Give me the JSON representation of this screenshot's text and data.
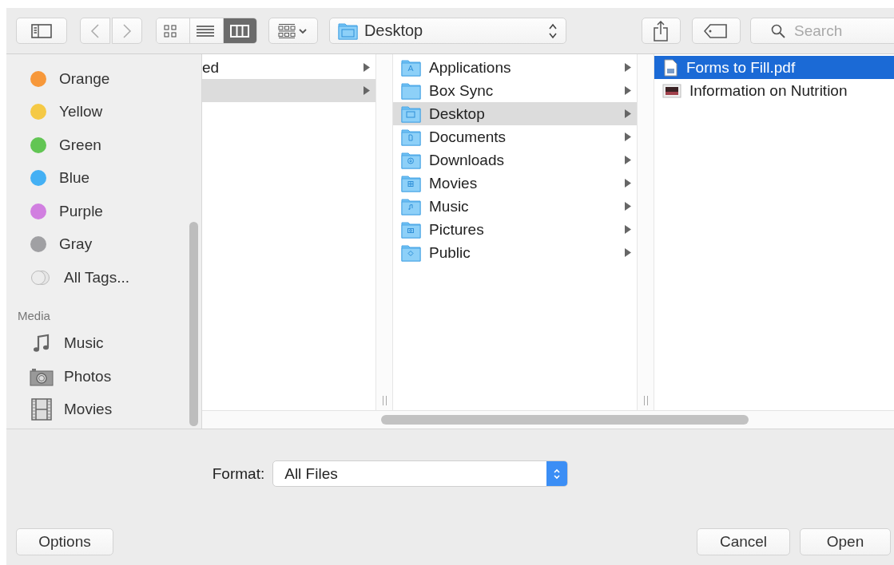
{
  "toolbar": {
    "view_modes": [
      {
        "kind": "icon",
        "selected": false
      },
      {
        "kind": "list",
        "selected": false
      },
      {
        "kind": "column",
        "selected": true
      }
    ],
    "location": "Desktop",
    "search": {
      "placeholder": "Search"
    }
  },
  "sidebar": {
    "tags": [
      {
        "label": "Orange",
        "color": "#f7983a"
      },
      {
        "label": "Yellow",
        "color": "#f5c945"
      },
      {
        "label": "Green",
        "color": "#62c554"
      },
      {
        "label": "Blue",
        "color": "#44b0f4"
      },
      {
        "label": "Purple",
        "color": "#d17fe0"
      },
      {
        "label": "Gray",
        "color": "#a0a0a3"
      }
    ],
    "all_tags": "All Tags...",
    "media": {
      "title": "Media",
      "items": [
        {
          "label": "Music",
          "kind": "music"
        },
        {
          "label": "Photos",
          "kind": "photos"
        },
        {
          "label": "Movies",
          "kind": "movies"
        }
      ]
    }
  },
  "columns": [
    {
      "rows": [
        {
          "label": "ed",
          "kind": "none",
          "selected": false
        },
        {
          "kind": "none",
          "selected": true
        }
      ]
    },
    {
      "rows": [
        {
          "label": "Applications",
          "kind": "applications",
          "selected": false
        },
        {
          "label": "Box Sync",
          "kind": "folder",
          "selected": false
        },
        {
          "label": "Desktop",
          "kind": "desktop",
          "selected": true
        },
        {
          "label": "Documents",
          "kind": "documents",
          "selected": false
        },
        {
          "label": "Downloads",
          "kind": "downloads",
          "selected": false
        },
        {
          "label": "Movies",
          "kind": "movies",
          "selected": false
        },
        {
          "label": "Music",
          "kind": "music",
          "selected": false
        },
        {
          "label": "Pictures",
          "kind": "pictures",
          "selected": false
        },
        {
          "label": "Public",
          "kind": "public",
          "selected": false
        }
      ]
    },
    {
      "rows": [
        {
          "label": "Forms to Fill.pdf",
          "kind": "pdf",
          "selected": true
        },
        {
          "label": "Information on Nutrition",
          "kind": "image",
          "selected": false
        }
      ]
    }
  ],
  "format": {
    "label": "Format:",
    "value": "All Files"
  },
  "buttons": {
    "left": [
      "Options"
    ],
    "right": [
      "Cancel",
      "Open"
    ]
  }
}
